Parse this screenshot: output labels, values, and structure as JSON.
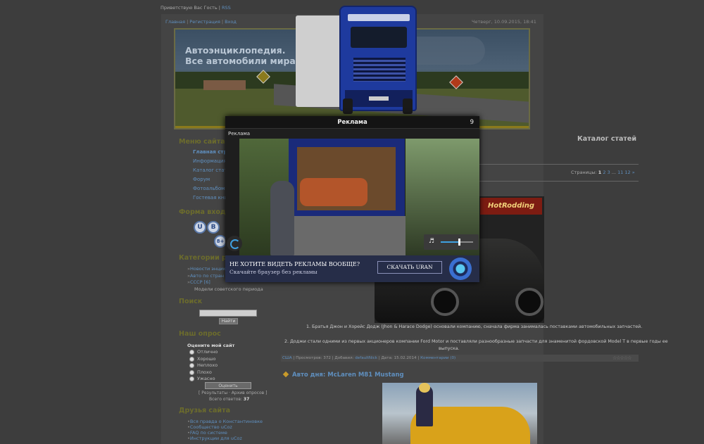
{
  "topbar": {
    "greeting": "Приветствую Вас Гость",
    "rss": "RSS"
  },
  "nav": {
    "home": "Главная",
    "register": "Регистрация",
    "login": "Вход"
  },
  "datetime": "Четверг, 10.09.2015, 18:41",
  "banner": {
    "slogan": "Автоэнциклопедия.\nВсе автомобили мира."
  },
  "sidebar": {
    "menu_title": "Меню сайта",
    "menu_items": [
      "Главная стр",
      "Информация",
      "Каталог стат",
      "Форум",
      "Фотоальбомы",
      "Гостевая кни"
    ],
    "login_title": "Форма входа",
    "login_icons": [
      "U",
      "B",
      "8+"
    ],
    "categories_title": "Категории ра",
    "categories": [
      {
        "label": "Новости энцик"
      },
      {
        "label": "Авто по стран"
      },
      {
        "label": "СССР [6]",
        "sub": "Модели советского периода"
      }
    ],
    "search_title": "Поиск",
    "search_button": "Найти",
    "poll_title": "Наш опрос",
    "poll_question": "Оцените мой сайт",
    "poll_options": [
      "Отлично",
      "Хорошо",
      "Неплохо",
      "Плохо",
      "Ужасно"
    ],
    "poll_button": "Оценить",
    "poll_links": "[ Результаты · Архив опросов ]",
    "poll_total_label": "Всего ответов:",
    "poll_total": "37",
    "friends_title": "Друзья сайта",
    "friends": [
      "Вся правда о Константиновке",
      "Сообщество uCoz",
      "FAQ по системе",
      "Инструкции для uCoz"
    ]
  },
  "main": {
    "catalog_title": "Каталог статей",
    "pages_label": "Страницы:",
    "pages_current": "1",
    "pages": [
      "2",
      "3",
      "...",
      "11",
      "12",
      "»"
    ],
    "magazine": "HotRodding",
    "para1": "1. Братья Джон и Хорейс Додж (Jhon & Harace Dodge) основали компанию, сначала фирма занималась поставками автомобильных запчастей.",
    "para2a": "2. Доджи стали одними из первых акционеров компании Ford Motor и поставляли разнообразные запчасти для знаменитой фордовской Model T в первые годы ее",
    "para2b": "выпуска.",
    "meta": {
      "category": "США",
      "views": "Просмотров: 372",
      "added_label": "Добавил:",
      "author": "defaultNick",
      "date": "Дата: 15.02.2014",
      "comments": "Комментарии (0)"
    },
    "stars": "☆☆☆☆☆",
    "auto_day": "Авто дня: McLaren M81 Mustang"
  },
  "ad": {
    "title": "Реклама",
    "countdown": "9",
    "label": "Реклама",
    "question": "НЕ ХОТИТЕ ВИДЕТЬ РЕКЛАМЫ ВООБЩЕ?",
    "sub": "Скачайте браузер без рекламы",
    "download": "СКАЧАТЬ URAN",
    "volume_level": 0.55
  }
}
